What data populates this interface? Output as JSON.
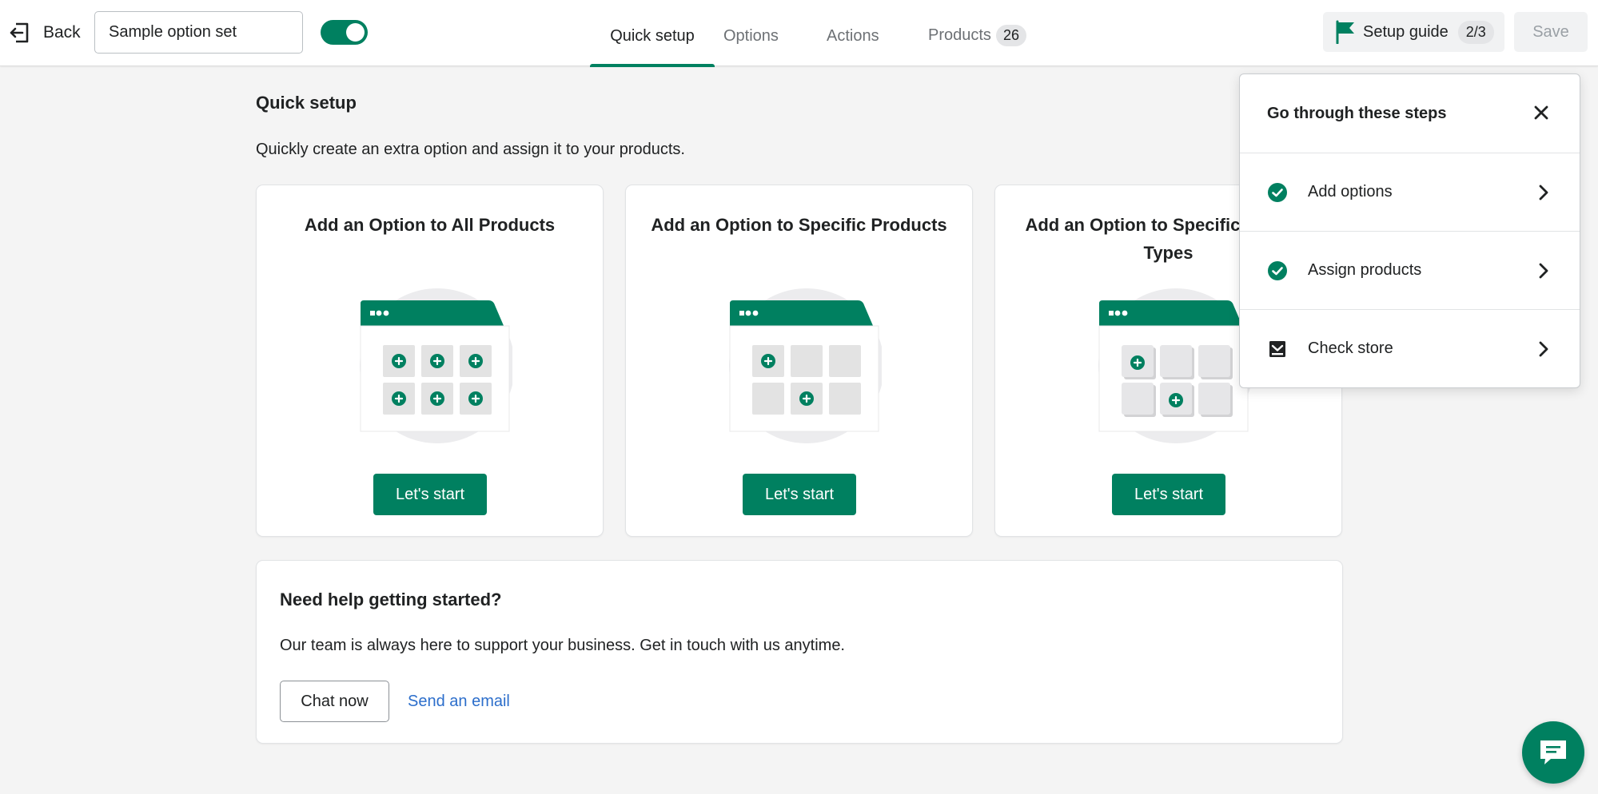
{
  "topbar": {
    "back_label": "Back",
    "option_set_name": "Sample option set",
    "toggle_on": true,
    "tabs": [
      {
        "label": "Quick setup",
        "active": true
      },
      {
        "label": "Options",
        "active": false
      },
      {
        "label": "Actions",
        "active": false
      },
      {
        "label": "Products",
        "count": "26",
        "active": false
      }
    ],
    "setup_guide_label": "Setup guide",
    "setup_guide_progress": "2/3",
    "save_label": "Save"
  },
  "main": {
    "title": "Quick setup",
    "description": "Quickly create an extra option and assign it to your products.",
    "cards": [
      {
        "title": "Add an Option to All Products",
        "button": "Let's start",
        "illustration": "all-products-grid"
      },
      {
        "title": "Add an Option to Specific Products",
        "button": "Let's start",
        "illustration": "specific-products-grid"
      },
      {
        "title": "Add an Option to Specific Product Types",
        "button": "Let's start",
        "illustration": "product-types-grid"
      }
    ]
  },
  "help": {
    "title": "Need help getting started?",
    "description": "Our team is always here to support your business. Get in touch with us anytime.",
    "chat_label": "Chat now",
    "email_label": "Send an email"
  },
  "guide": {
    "title": "Go through these steps",
    "steps": [
      {
        "label": "Add options",
        "status": "done"
      },
      {
        "label": "Assign products",
        "status": "done"
      },
      {
        "label": "Check store",
        "status": "pending"
      }
    ]
  },
  "colors": {
    "accent": "#008060",
    "link": "#2c6ecb",
    "background": "#f4f4f4"
  }
}
